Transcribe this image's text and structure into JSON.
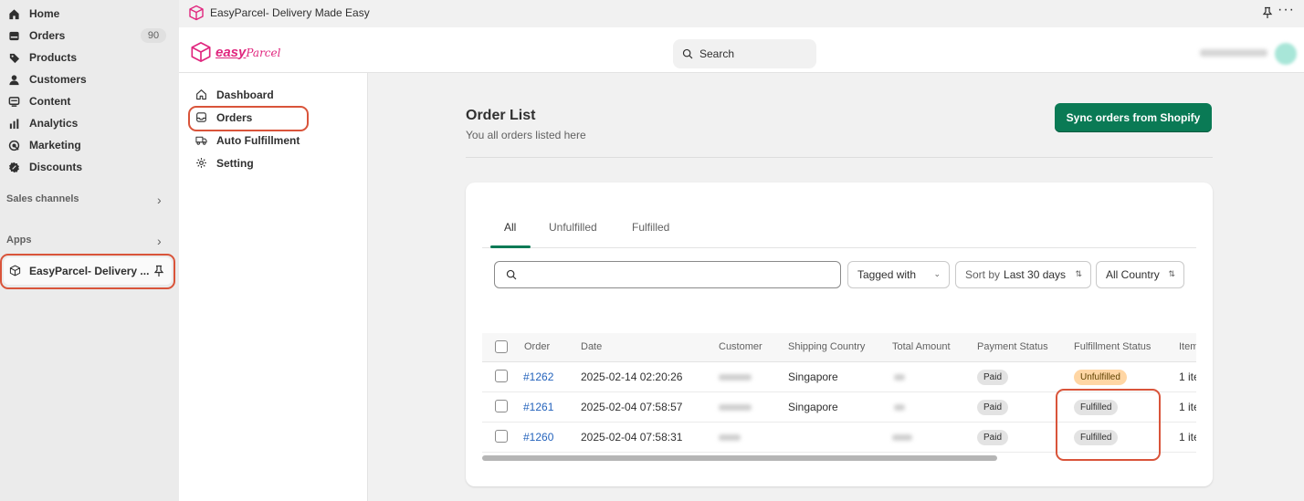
{
  "admin_nav": {
    "items": [
      {
        "label": "Home",
        "icon": "home-icon"
      },
      {
        "label": "Orders",
        "icon": "orders-icon",
        "badge": "90"
      },
      {
        "label": "Products",
        "icon": "tag-icon"
      },
      {
        "label": "Customers",
        "icon": "person-icon"
      },
      {
        "label": "Content",
        "icon": "content-icon"
      },
      {
        "label": "Analytics",
        "icon": "analytics-icon"
      },
      {
        "label": "Marketing",
        "icon": "target-icon"
      },
      {
        "label": "Discounts",
        "icon": "discount-icon"
      }
    ],
    "sales_channels": "Sales channels",
    "apps": "Apps",
    "app_entry": "EasyParcel- Delivery ..."
  },
  "top_strip": {
    "title": "EasyParcel- Delivery Made Easy"
  },
  "header": {
    "brand": "easy",
    "brand_script": "Parcel",
    "search_label": "Search"
  },
  "app_sidebar": {
    "items": [
      {
        "label": "Dashboard",
        "icon": "home-outline-icon"
      },
      {
        "label": "Orders",
        "icon": "inbox-icon"
      },
      {
        "label": "Auto Fulfillment",
        "icon": "truck-icon"
      },
      {
        "label": "Setting",
        "icon": "gear-icon"
      }
    ]
  },
  "page": {
    "title": "Order List",
    "subtitle": "You all orders listed here",
    "sync_label": "Sync orders from Shopify"
  },
  "tabs": [
    "All",
    "Unfulfilled",
    "Fulfilled"
  ],
  "filters": {
    "search_placeholder": "",
    "tagged": "Tagged with",
    "sort_prefix": "Sort by",
    "sort_value": "Last 30 days",
    "country": "All Country"
  },
  "table": {
    "columns": [
      "Order",
      "Date",
      "Customer",
      "Shipping Country",
      "Total Amount",
      "Payment Status",
      "Fulfillment Status",
      "Item"
    ],
    "rows": [
      {
        "order": "#1262",
        "date": "2025-02-14 02:20:26",
        "country": "Singapore",
        "payment": "Paid",
        "fulfillment": "Unfulfilled",
        "items": "1 ite"
      },
      {
        "order": "#1261",
        "date": "2025-02-04 07:58:57",
        "country": "Singapore",
        "payment": "Paid",
        "fulfillment": "Fulfilled",
        "items": "1 ite"
      },
      {
        "order": "#1260",
        "date": "2025-02-04 07:58:31",
        "country": "",
        "payment": "Paid",
        "fulfillment": "Fulfilled",
        "items": "1 ite"
      }
    ]
  },
  "colors": {
    "accent": "#0a7a55",
    "highlight": "#d9543a",
    "link": "#2463bc",
    "brand": "#e0267e"
  }
}
